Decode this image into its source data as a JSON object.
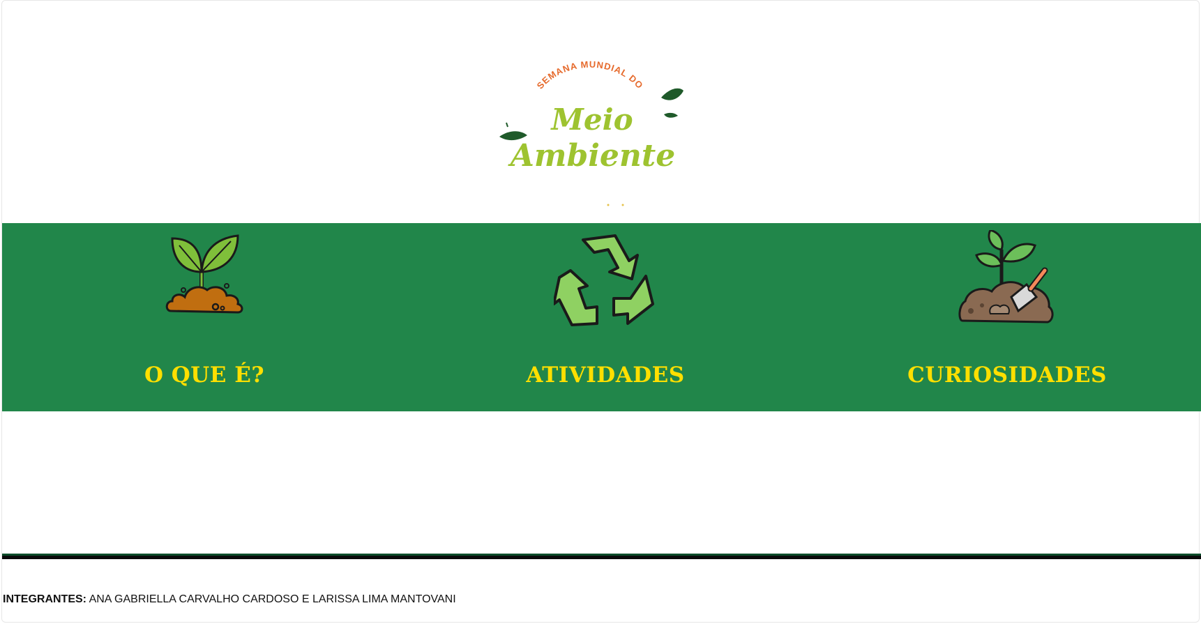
{
  "logo": {
    "line1": "SEMANA MUNDIAL DO",
    "line2": "Meio",
    "line3": "Ambiente",
    "colors": {
      "arc": "#e66a2c",
      "word": "#9ec330",
      "leaf": "#1f5a2a"
    }
  },
  "nav": {
    "items": [
      {
        "label": "O QUE É?",
        "icon": "sprout-soil-icon"
      },
      {
        "label": "ATIVIDADES",
        "icon": "recycle-icon"
      },
      {
        "label": "CURIOSIDADES",
        "icon": "plant-trowel-icon"
      }
    ]
  },
  "footer": {
    "label": "INTEGRANTES:",
    "names": " ANA GABRIELLA CARVALHO CARDOSO E LARISSA LIMA MANTOVANI"
  },
  "colors": {
    "band": "#21864a",
    "nav_text": "#ffdf00",
    "divider": "#0a0a0a"
  }
}
